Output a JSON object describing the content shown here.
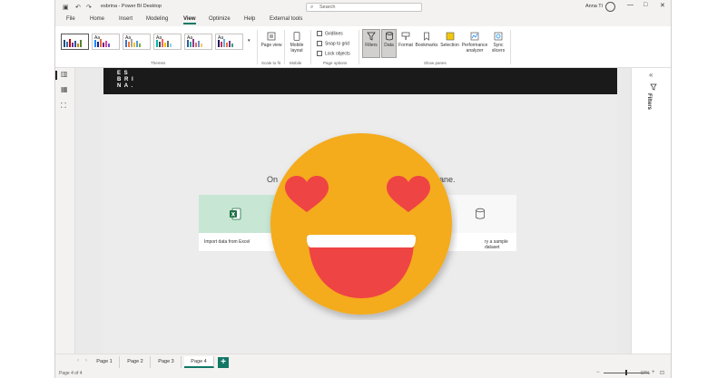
{
  "window": {
    "title": "esbrina - Power BI Desktop",
    "search_placeholder": "Search",
    "user_name": "Anna Tí",
    "controls": {
      "minimize": "—",
      "maximize": "□",
      "close": "✕"
    }
  },
  "menu": {
    "items": [
      "File",
      "Home",
      "Insert",
      "Modeling",
      "View",
      "Optimize",
      "Help",
      "External tools"
    ],
    "active": "View"
  },
  "ribbon": {
    "themes": {
      "label": "Themes",
      "tile_text": "Aa"
    },
    "scale": {
      "button": "Page view",
      "label": "Scale to fit"
    },
    "mobile": {
      "button": "Mobile layout",
      "label": "Mobile"
    },
    "page_options": {
      "label": "Page options",
      "checkboxes": [
        "Gridlines",
        "Snap to grid",
        "Lock objects"
      ]
    },
    "show_panes": {
      "label": "Show panes",
      "buttons": [
        "Filters",
        "Data",
        "Format",
        "Bookmarks",
        "Selection",
        "Performance analyzer",
        "Sync slicers"
      ]
    }
  },
  "canvas": {
    "logo_lines": [
      "E S",
      "B R I",
      "N A ."
    ],
    "hint_left": "On",
    "hint_right": "ane.",
    "cards": [
      {
        "label": "Import data from Excel",
        "icon": "excel-icon"
      },
      {
        "label": "ry a sample dataset",
        "icon": "dataset-icon"
      }
    ]
  },
  "right_pane": {
    "label": "Filters",
    "collapse": "«"
  },
  "tabs": {
    "items": [
      "Page 1",
      "Page 2",
      "Page 3",
      "Page 4"
    ],
    "active": "Page 4",
    "add": "+"
  },
  "status": {
    "page": "Page 4 of 4",
    "zoom": "97%"
  },
  "colors": {
    "accent": "#117865",
    "emoji_face": "#F4AB1E",
    "emoji_heart": "#EF4444",
    "excel_green": "#1D7044"
  }
}
